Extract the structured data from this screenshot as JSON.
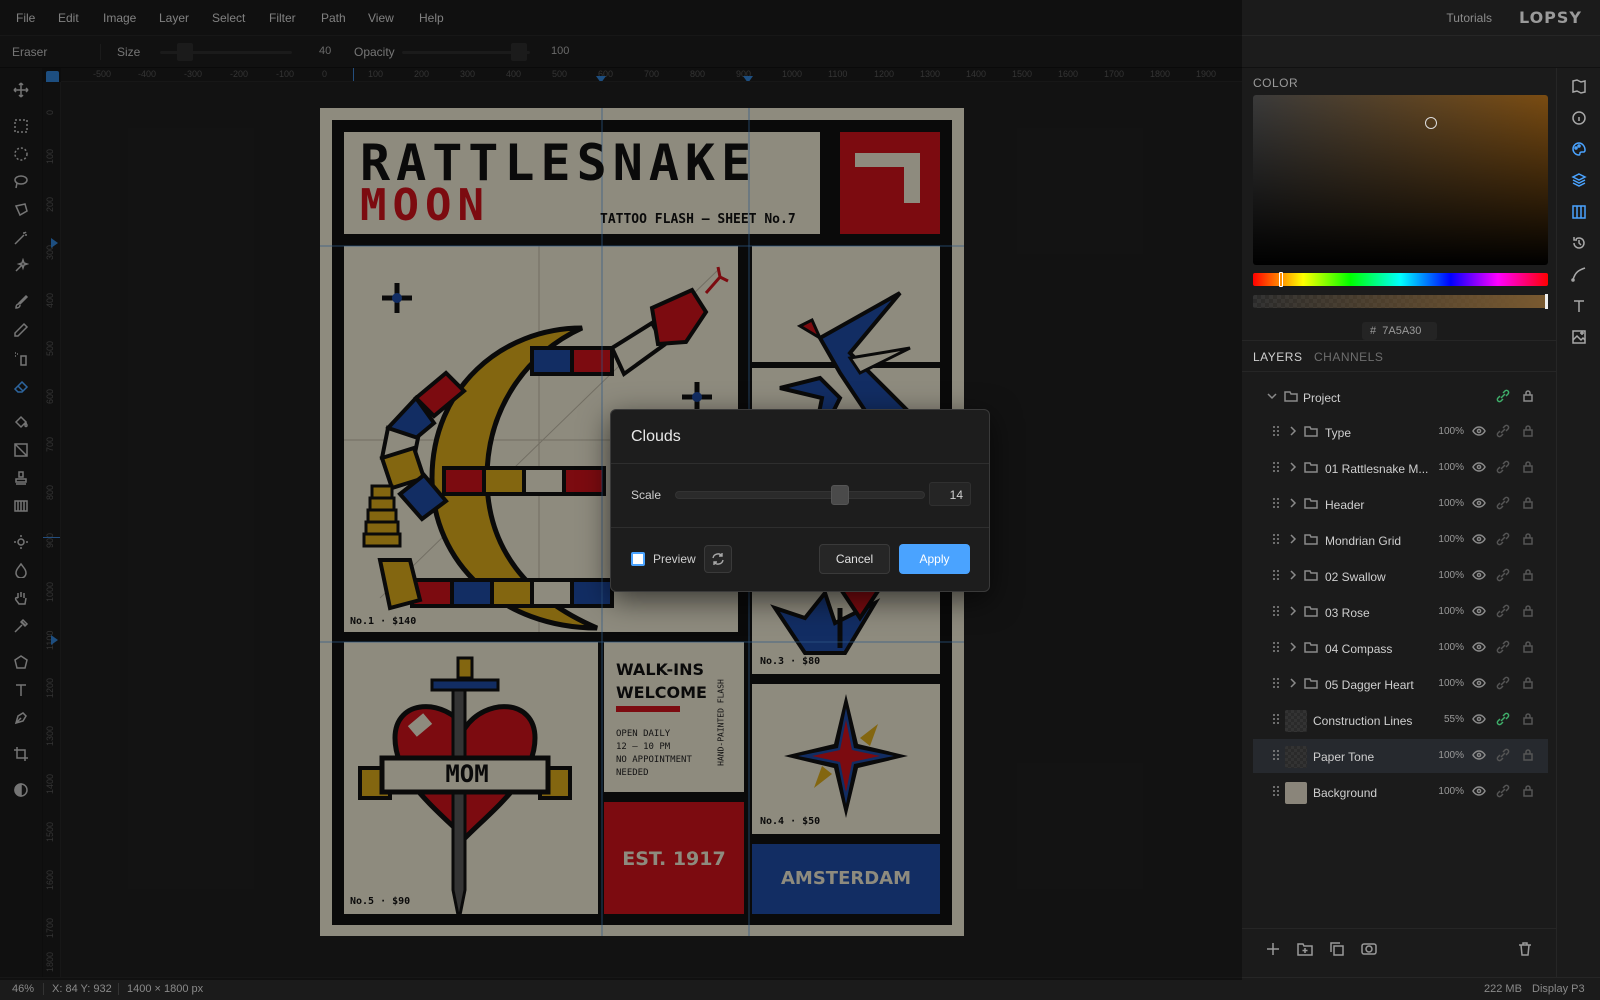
{
  "menu": [
    "File",
    "Edit",
    "Image",
    "Layer",
    "Select",
    "Filter",
    "Path",
    "View",
    "Help"
  ],
  "header": {
    "tutorials": "Tutorials",
    "brand": "LOPSY"
  },
  "options": {
    "tool": "Eraser",
    "size_label": "Size",
    "size_value": "40",
    "opacity_label": "Opacity",
    "opacity_value": "100"
  },
  "ruler_top": [
    "-500",
    "-400",
    "-300",
    "-200",
    "-100",
    "0",
    "100",
    "200",
    "300",
    "400",
    "500",
    "600",
    "700",
    "800",
    "900",
    "1000",
    "1100",
    "1200",
    "1300",
    "1400",
    "1500",
    "1600",
    "1700",
    "1800",
    "1900"
  ],
  "ruler_left": [
    "0",
    "100",
    "200",
    "300",
    "400",
    "500",
    "600",
    "700",
    "800",
    "900",
    "1000",
    "1100",
    "1200",
    "1300",
    "1400",
    "1500",
    "1600",
    "1700",
    "1800"
  ],
  "poster": {
    "title_line1": "RATTLESNAKE",
    "title_line2": "MOON",
    "subtitle": "TATTOO FLASH — SHEET No.7",
    "number": "7",
    "panel1_caption": "No.1 · $140",
    "panel3_caption": "No.3 · $80",
    "panel4_caption": "No.4 · $50",
    "panel5_caption": "No.5 · $90",
    "heart_banner": "MOM",
    "walkins_line1": "WALK-INS",
    "walkins_line2": "WELCOME",
    "hours": [
      "OPEN DAILY",
      "12 – 10 PM",
      "NO APPOINTMENT",
      "NEEDED"
    ],
    "vertical_text": "HAND-PAINTED FLASH",
    "est": "EST. 1917",
    "city": "AMSTERDAM"
  },
  "colors": {
    "accent": "#4aa3ff",
    "poster_red": "#c8121b",
    "poster_blue": "#1d4aa0",
    "poster_yellow": "#d3a51a",
    "paper": "#e6e0cc",
    "ink": "#111111",
    "current_color": "#7A5A30"
  },
  "color_panel": {
    "title": "COLOR",
    "hex_prefix": "#",
    "hex": "7A5A30"
  },
  "tabs": {
    "layers": "LAYERS",
    "channels": "CHANNELS"
  },
  "layers": [
    {
      "name": "Project",
      "opacity": "",
      "kind": "group-root"
    },
    {
      "name": "Type",
      "opacity": "100%",
      "kind": "group"
    },
    {
      "name": "01 Rattlesnake M...",
      "opacity": "100%",
      "kind": "group"
    },
    {
      "name": "Header",
      "opacity": "100%",
      "kind": "group"
    },
    {
      "name": "Mondrian Grid",
      "opacity": "100%",
      "kind": "group"
    },
    {
      "name": "02 Swallow",
      "opacity": "100%",
      "kind": "group"
    },
    {
      "name": "03 Rose",
      "opacity": "100%",
      "kind": "group"
    },
    {
      "name": "04 Compass",
      "opacity": "100%",
      "kind": "group"
    },
    {
      "name": "05 Dagger Heart",
      "opacity": "100%",
      "kind": "group"
    },
    {
      "name": "Construction Lines",
      "opacity": "55%",
      "kind": "layer"
    },
    {
      "name": "Paper Tone",
      "opacity": "100%",
      "kind": "layer",
      "selected": true
    },
    {
      "name": "Background",
      "opacity": "100%",
      "kind": "layer"
    }
  ],
  "dialog": {
    "title": "Clouds",
    "scale_label": "Scale",
    "scale_value": "14",
    "scale_fraction": 0.66,
    "preview_label": "Preview",
    "cancel": "Cancel",
    "apply": "Apply"
  },
  "status": {
    "zoom": "46%",
    "coords": "X: 84 Y: 932",
    "doc_size": "1400 × 1800 px",
    "memory": "222 MB",
    "profile": "Display P3"
  }
}
